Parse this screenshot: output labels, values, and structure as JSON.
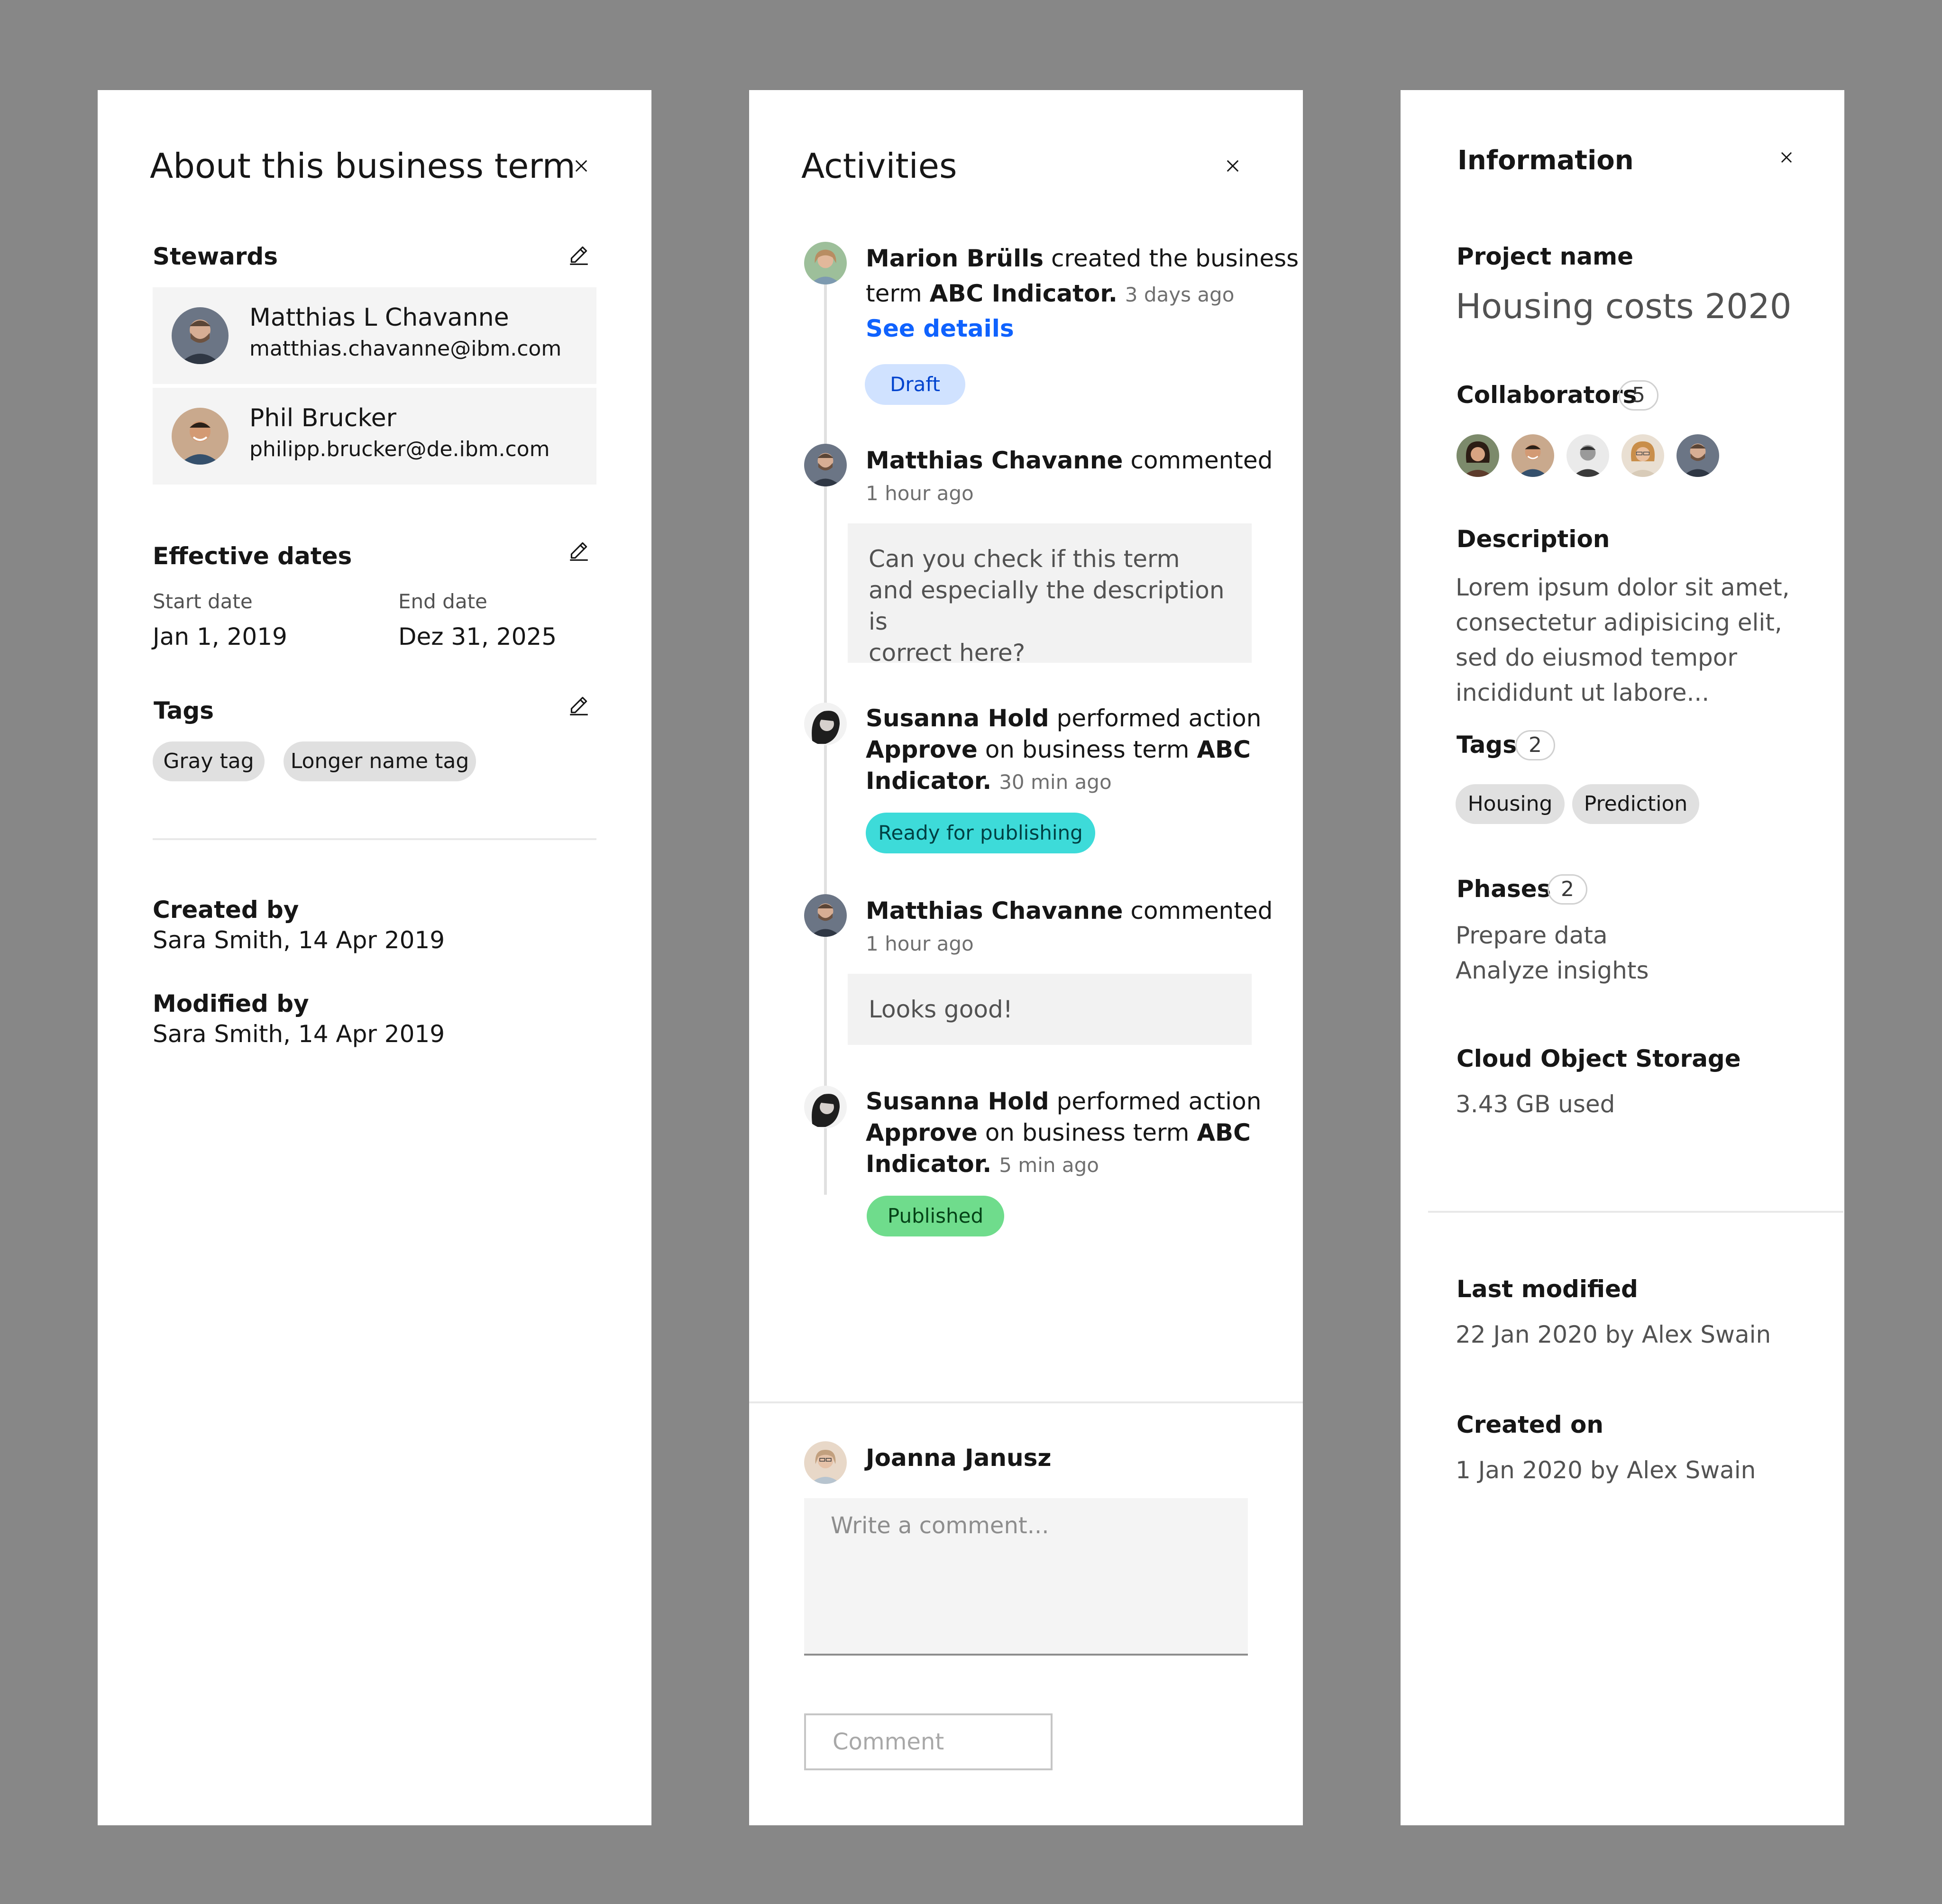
{
  "about": {
    "title": "About this business term",
    "stewards_label": "Stewards",
    "stewards": [
      {
        "name": "Matthias L Chavanne",
        "email": "matthias.chavanne@ibm.com"
      },
      {
        "name": "Phil Brucker",
        "email": "philipp.brucker@de.ibm.com"
      }
    ],
    "effective_dates_label": "Effective dates",
    "start_label": "Start date",
    "start_value": "Jan 1, 2019",
    "end_label": "End date",
    "end_value": "Dez 31, 2025",
    "tags_label": "Tags",
    "tags": [
      "Gray tag",
      "Longer name tag"
    ],
    "created_by_label": "Created by",
    "created_by_value": "Sara Smith, 14 Apr 2019",
    "modified_by_label": "Modified by",
    "modified_by_value": "Sara Smith, 14 Apr 2019"
  },
  "activities": {
    "title": "Activities",
    "items": [
      {
        "author": "Marion Brülls",
        "text_1": "created the business",
        "text_2": "term",
        "object": "ABC Indicator",
        "time": "3 days ago",
        "link": "See details",
        "status": "Draft"
      },
      {
        "author": "Matthias Chavanne",
        "text_1": "commented",
        "time": "1 hour ago",
        "comment": [
          "Can you check if this term",
          "and especially the description is",
          "correct here?"
        ]
      },
      {
        "author": "Susanna Hold",
        "text_1": "performed action",
        "action": "Approve",
        "text_2": "on business term",
        "object_a": "ABC",
        "object_b": "Indicator",
        "time": "30 min ago",
        "status": "Ready for publishing"
      },
      {
        "author": "Matthias Chavanne",
        "text_1": "commented",
        "time": "1 hour ago",
        "comment": [
          "Looks good!"
        ]
      },
      {
        "author": "Susanna Hold",
        "text_1": "performed action",
        "action": "Approve",
        "text_2": "on business term",
        "object_a": "ABC",
        "object_b": "Indicator",
        "time": "5 min ago",
        "status": "Published"
      }
    ],
    "composer": {
      "author": "Joanna Janusz",
      "placeholder": "Write a comment...",
      "button": "Comment"
    }
  },
  "info": {
    "title": "Information",
    "project_label": "Project name",
    "project_value": "Housing costs 2020",
    "collaborators_label": "Collaborators",
    "collaborators_count": "5",
    "description_label": "Description",
    "description_lines": [
      "Lorem ipsum dolor sit amet,",
      "consectetur adipisicing elit,",
      "sed do eiusmod tempor",
      "incididunt ut labore..."
    ],
    "tags_label": "Tags",
    "tags_count": "2",
    "tags": [
      "Housing",
      "Prediction"
    ],
    "phases_label": "Phases",
    "phases_count": "2",
    "phases": [
      "Prepare data",
      "Analyze insights"
    ],
    "storage_label": "Cloud Object Storage",
    "storage_value": "3.43 GB used",
    "last_modified_label": "Last modified",
    "last_modified_value": "22 Jan 2020 by Alex Swain",
    "created_on_label": "Created on",
    "created_on_value": "1 Jan 2020 by Alex Swain"
  },
  "colors": {
    "draft_bg": "#d0e2ff",
    "draft_fg": "#0043ce",
    "ready_bg": "#3ddbd9",
    "ready_fg": "#004144",
    "published_bg": "#6fdc8c",
    "published_fg": "#044317",
    "link": "#0f62fe"
  },
  "icons": {
    "close": "close-icon",
    "edit": "edit-icon"
  }
}
